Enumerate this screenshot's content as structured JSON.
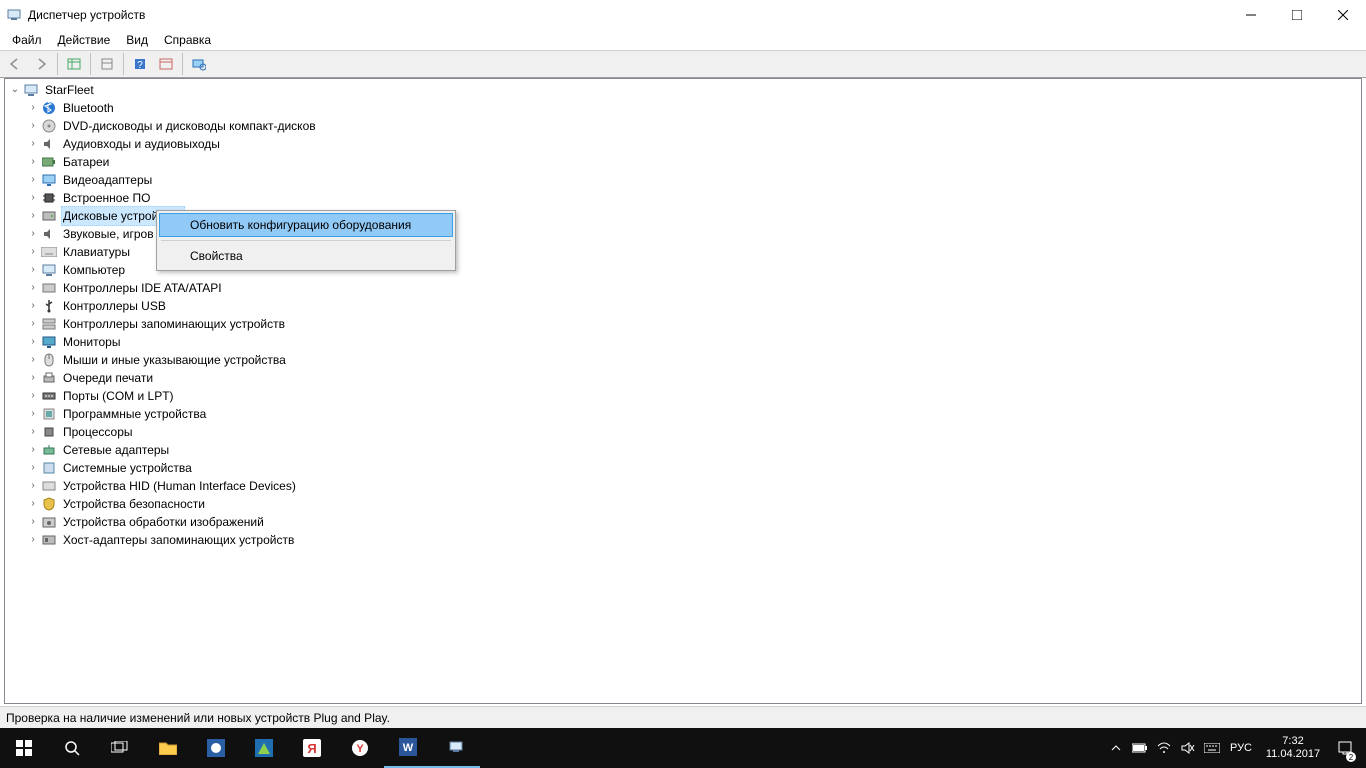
{
  "window": {
    "title": "Диспетчер устройств"
  },
  "menubar": {
    "items": [
      "Файл",
      "Действие",
      "Вид",
      "Справка"
    ]
  },
  "tree": {
    "root": "StarFleet",
    "root_expanded": true,
    "selected_index": 7,
    "nodes": [
      {
        "label": "Bluetooth",
        "icon": "bluetooth"
      },
      {
        "label": "DVD-дисководы и дисководы компакт-дисков",
        "icon": "disc"
      },
      {
        "label": "Аудиовходы и аудиовыходы",
        "icon": "audio"
      },
      {
        "label": "Батареи",
        "icon": "battery"
      },
      {
        "label": "Видеоадаптеры",
        "icon": "display"
      },
      {
        "label": "Встроенное ПО",
        "icon": "chip"
      },
      {
        "label": "Дисковые устройства",
        "icon": "disk"
      },
      {
        "label": "Звуковые, игровые и видеоустройства",
        "icon": "audio",
        "truncated": "Звуковые, игров"
      },
      {
        "label": "Клавиатуры",
        "icon": "keyboard"
      },
      {
        "label": "Компьютер",
        "icon": "computer"
      },
      {
        "label": "Контроллеры IDE ATA/ATAPI",
        "icon": "ide"
      },
      {
        "label": "Контроллеры USB",
        "icon": "usb"
      },
      {
        "label": "Контроллеры запоминающих устройств",
        "icon": "storage"
      },
      {
        "label": "Мониторы",
        "icon": "monitor"
      },
      {
        "label": "Мыши и иные указывающие устройства",
        "icon": "mouse"
      },
      {
        "label": "Очереди печати",
        "icon": "printer"
      },
      {
        "label": "Порты (COM и LPT)",
        "icon": "port"
      },
      {
        "label": "Программные устройства",
        "icon": "software"
      },
      {
        "label": "Процессоры",
        "icon": "cpu"
      },
      {
        "label": "Сетевые адаптеры",
        "icon": "network"
      },
      {
        "label": "Системные устройства",
        "icon": "system"
      },
      {
        "label": "Устройства HID (Human Interface Devices)",
        "icon": "hid"
      },
      {
        "label": "Устройства безопасности",
        "icon": "security"
      },
      {
        "label": "Устройства обработки изображений",
        "icon": "imaging"
      },
      {
        "label": "Хост-адаптеры запоминающих устройств",
        "icon": "hostadapter"
      }
    ]
  },
  "context_menu": {
    "visible": true,
    "anchor_index": 6,
    "items": [
      {
        "label": "Обновить конфигурацию оборудования",
        "highlight": true
      },
      {
        "separator": true
      },
      {
        "label": "Свойства",
        "highlight": false
      }
    ]
  },
  "statusbar": {
    "text": "Проверка на наличие изменений или новых устройств Plug and Play."
  },
  "taskbar": {
    "lang": "РУС",
    "time": "7:32",
    "date": "11.04.2017",
    "notif_count": "2"
  }
}
